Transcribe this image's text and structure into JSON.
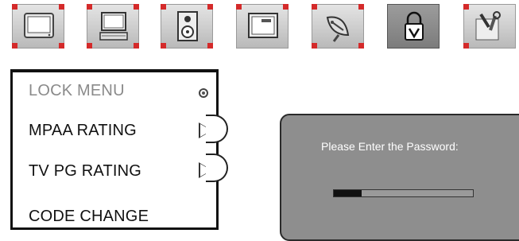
{
  "tabs": [
    {
      "icon": "tv-screen-icon"
    },
    {
      "icon": "pc-monitor-icon"
    },
    {
      "icon": "speaker-icon"
    },
    {
      "icon": "window-screen-icon"
    },
    {
      "icon": "satellite-dish-icon"
    },
    {
      "icon": "lock-icon",
      "active": true
    },
    {
      "icon": "tools-icon"
    }
  ],
  "menu": {
    "title": "LOCK MENU",
    "items": [
      {
        "label": "MPAA RATING"
      },
      {
        "label": "TV PG RATING"
      },
      {
        "label": "CODE CHANGE"
      }
    ]
  },
  "dialog": {
    "title": "Please Enter the Password:",
    "progress": 0.2
  },
  "colors": {
    "corner_marker": "#d42a2a",
    "dialog_bg": "#8e8e8e"
  }
}
